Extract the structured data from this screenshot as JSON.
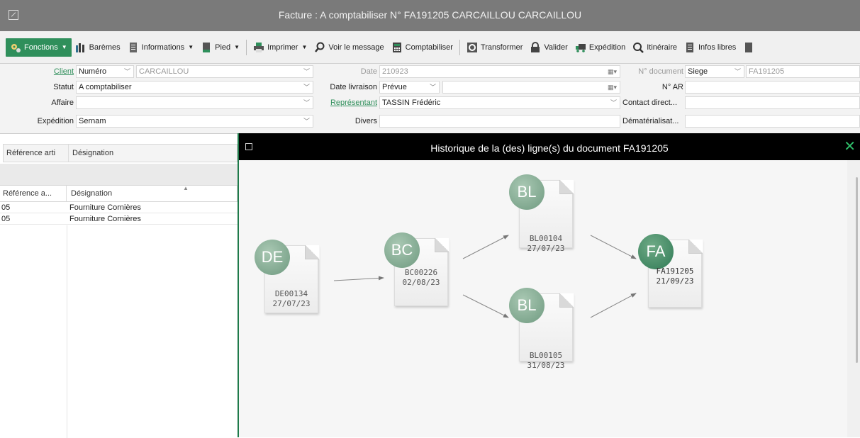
{
  "window": {
    "title": "Facture : A comptabiliser N° FA191205 CARCAILLOU CARCAILLOU"
  },
  "toolbar": {
    "fonctions": "Fonctions",
    "baremes": "Barèmes",
    "informations": "Informations",
    "pied": "Pied",
    "imprimer": "Imprimer",
    "voir_message": "Voir le message",
    "comptabiliser": "Comptabiliser",
    "transformer": "Transformer",
    "valider": "Valider",
    "expedition": "Expédition",
    "itineraire": "Itinéraire",
    "infos_libres": "Infos libres"
  },
  "form": {
    "client_label": "Client",
    "client_type": "Numéro",
    "client_value": "CARCAILLOU",
    "statut_label": "Statut",
    "statut_value": "A comptabiliser",
    "affaire_label": "Affaire",
    "affaire_value": "",
    "expedition_label": "Expédition",
    "expedition_value": "Sernam",
    "date_label": "Date",
    "date_value": "210923",
    "date_livraison_label": "Date livraison",
    "date_livraison_value": "Prévue",
    "representant_label": "Représentant",
    "representant_value": "TASSIN Frédéric",
    "divers_label": "Divers",
    "n_document_label": "N° document",
    "n_document_site": "Siege",
    "n_document_value": "FA191205",
    "n_ar_label": "N° AR",
    "contact_label": "Contact direct...",
    "dematerialisation_label": "Dématérialisat..."
  },
  "left_grid": {
    "filter_headers": [
      "Référence arti",
      "Désignation"
    ],
    "headers": [
      "Référence a...",
      "Désignation"
    ],
    "rows": [
      [
        "05",
        "Fourniture Cornières"
      ],
      [
        "05",
        "Fourniture Cornières"
      ]
    ]
  },
  "modal": {
    "title": "Historique de la (des) ligne(s) du document FA191205",
    "close": "✕",
    "nodes": [
      {
        "badge": "DE",
        "number": "DE00134",
        "date": "27/07/23"
      },
      {
        "badge": "BC",
        "number": "BC00226",
        "date": "02/08/23"
      },
      {
        "badge": "BL",
        "number": "BL00104",
        "date": "27/07/23"
      },
      {
        "badge": "BL",
        "number": "BL00105",
        "date": "31/08/23"
      },
      {
        "badge": "FA",
        "number": "FA191205",
        "date": "21/09/23"
      }
    ]
  },
  "colors": {
    "accent": "#2f8f5b",
    "modal_header": "#000000",
    "title_bar": "#7a7a7a"
  }
}
